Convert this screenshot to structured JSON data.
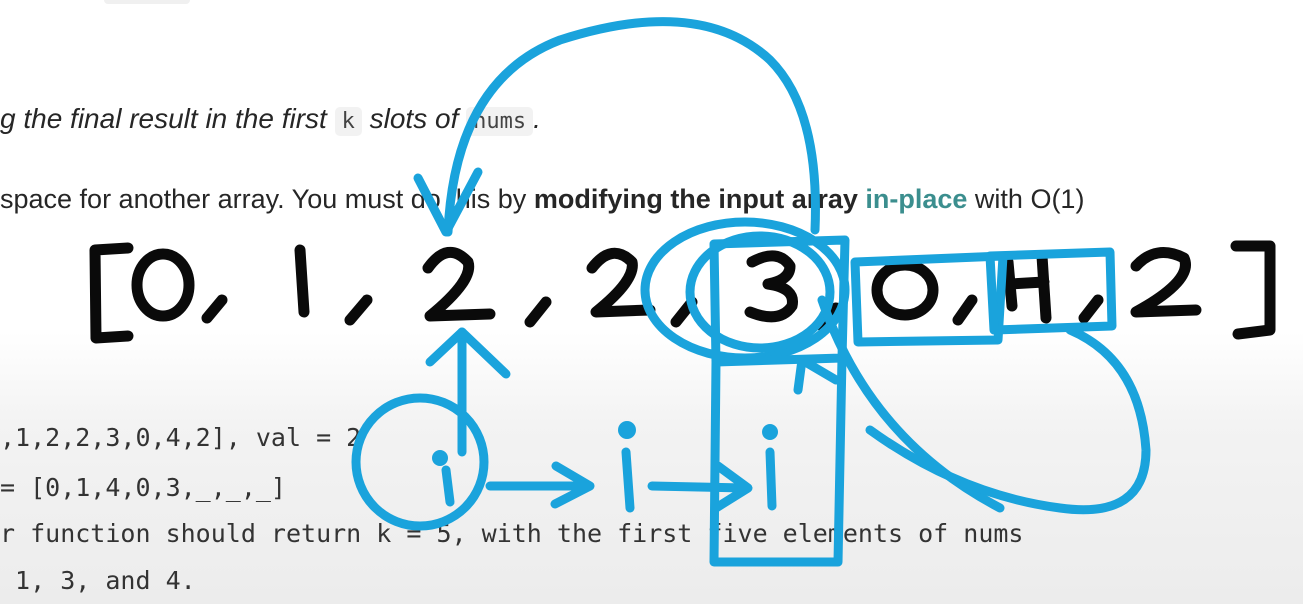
{
  "text": {
    "line1_part1": "g the final result in the first",
    "line1_code_k": "k",
    "line1_part2": "slots of",
    "line1_code_nums": "nums",
    "line1_end": ".",
    "line2_part1": " space for another array. You must do this by",
    "line2_bold1": "modifying the input array",
    "line2_link": "in-place",
    "line2_part2": "with O(1)",
    "code1": ",1,2,2,3,0,4,2], val = 2",
    "code2": "= [0,1,4,0,3,_,_,_]",
    "code3": "r function should return k = 5, with the first five elements of nums",
    "code4": " 1, 3, and 4."
  },
  "annotation": {
    "ink_colors": {
      "array": "#0a0a0a",
      "pointer": "#1aa3dc"
    },
    "array_glyphs": [
      "[",
      "0",
      ",",
      "1",
      ",",
      "2",
      ",",
      "2",
      ",",
      "3",
      ",",
      "0",
      ",",
      "4",
      ",",
      "2",
      "]"
    ],
    "pointer_labels": [
      "i",
      "i",
      "i"
    ]
  }
}
